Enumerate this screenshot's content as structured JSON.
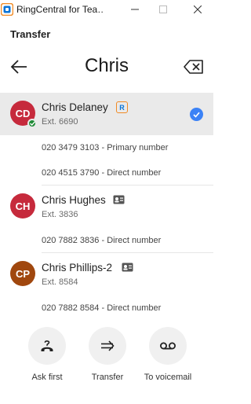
{
  "window": {
    "title": "RingCentral for Tea…",
    "min_icon": "minimize-icon",
    "max_icon": "maximize-icon",
    "close_icon": "close-icon"
  },
  "header": {
    "title": "Transfer"
  },
  "search": {
    "value": "Chris",
    "back_icon": "arrow-left-icon",
    "clear_icon": "backspace-clear-icon"
  },
  "contacts": [
    {
      "initials": "CD",
      "name": "Chris Delaney",
      "ext": "Ext. 6690",
      "avatar_color": "#c62a3c",
      "presence": "available",
      "badge": "ringcentral-icon",
      "badge_text": "R",
      "selected": true,
      "numbers": [
        {
          "number": "020 3479 3103",
          "sep": " - ",
          "type": "Primary number"
        },
        {
          "number": "020 4515 3790",
          "sep": " - ",
          "type": "Direct number"
        }
      ]
    },
    {
      "initials": "CH",
      "name": "Chris Hughes",
      "ext": "Ext. 3836",
      "avatar_color": "#c62a3c",
      "badge": "contact-card-icon",
      "selected": false,
      "numbers": [
        {
          "number": "020 7882 3836",
          "sep": " - ",
          "type": "Direct number"
        }
      ]
    },
    {
      "initials": "CP",
      "name": "Chris Phillips-2",
      "ext": "Ext. 8584",
      "avatar_color": "#a0470e",
      "badge": "contact-card-icon",
      "selected": false,
      "numbers": [
        {
          "number": "020 7882 8584",
          "sep": " - ",
          "type": "Direct number"
        }
      ]
    }
  ],
  "actions": [
    {
      "label": "Ask first",
      "icon": "ask-first-icon"
    },
    {
      "label": "Transfer",
      "icon": "transfer-arrow-icon"
    },
    {
      "label": "To voicemail",
      "icon": "voicemail-icon"
    }
  ],
  "colors": {
    "accent": "#3b82f6",
    "brand": "#f08a24",
    "presence": "#1e8a36"
  }
}
